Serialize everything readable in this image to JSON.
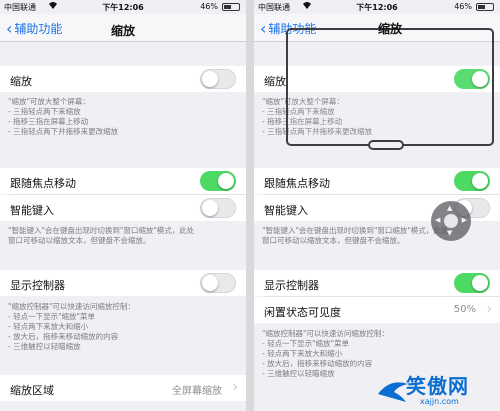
{
  "status": {
    "carrier": "中国联通",
    "time": "下午12:06",
    "battery": "46%"
  },
  "nav": {
    "back_label": "辅助功能",
    "title": "缩放"
  },
  "left": {
    "zoom": {
      "label": "缩放",
      "on": false
    },
    "zoom_note": [
      "\"缩放\"可放大整个屏幕：",
      "- 三指轻点两下来缩放",
      "- 拖移三指在屏幕上移动",
      "- 三指轻点两下并拖移来更改缩放"
    ],
    "follow_focus": {
      "label": "跟随焦点移动",
      "on": true
    },
    "smart_typing": {
      "label": "智能键入",
      "on": false
    },
    "smart_note": [
      "\"智能键入\"会在键盘出现时切换到\"窗口缩放\"模式，此处",
      "窗口可移动以缩放文本，但键盘不会缩放。"
    ],
    "show_controller": {
      "label": "显示控制器",
      "on": false
    },
    "controller_note": [
      "\"缩放控制器\"可以快速访问缩放控制：",
      "- 轻点一下显示\"缩放\"菜单",
      "- 轻点两下来放大和缩小",
      "- 放大后，拖移来移动缩放的内容",
      "- 三维触控以轻瞄缩放"
    ],
    "zoom_region": {
      "label": "缩放区域",
      "value": "全屏幕缩放"
    }
  },
  "right": {
    "zoom": {
      "label": "缩放",
      "on": true
    },
    "zoom_note": [
      "\"缩放\"可放大整个屏幕：",
      "- 三指轻点两下来缩放",
      "- 拖移三指在屏幕上移动",
      "- 三指轻点两下并拖移来更改缩放"
    ],
    "follow_focus": {
      "label": "跟随焦点移动",
      "on": true
    },
    "smart_typing": {
      "label": "智能键入",
      "on": false
    },
    "smart_note": [
      "\"智能键入\"会在键盘出现时切换到\"窗口缩放\"模式，此处",
      "窗口可移动以缩放文本，但键盘不会缩放。"
    ],
    "show_controller": {
      "label": "显示控制器",
      "on": true
    },
    "idle_visibility": {
      "label": "闲置状态可见度",
      "value": "50%"
    },
    "controller_note": [
      "\"缩放控制器\"可以快速访问缩放控制：",
      "- 轻点一下显示\"缩放\"菜单",
      "- 轻点两下来放大和缩小",
      "- 放大后，拖移来移动缩放的内容",
      "- 三维触控以轻瞄缩放"
    ]
  },
  "watermark": {
    "text": "笑傲网",
    "url": "xajjn.com"
  },
  "colors": {
    "toggle_on": "#4cd964",
    "link": "#1a73e8"
  }
}
